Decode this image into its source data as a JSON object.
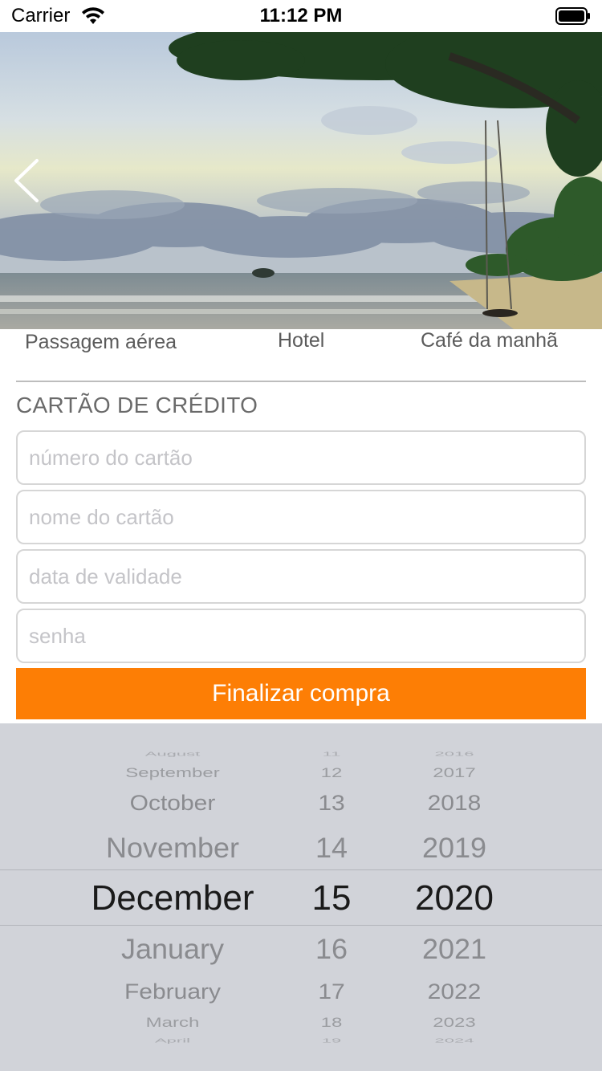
{
  "status_bar": {
    "carrier": "Carrier",
    "time": "11:12 PM"
  },
  "hero": {
    "image_description_icon": "beach-photo",
    "back_icon": "chevron-left-icon"
  },
  "tabs": [
    {
      "label": "Passagem aérea"
    },
    {
      "label": "Hotel"
    },
    {
      "label": "Café da manhã"
    }
  ],
  "section": {
    "title": "CARTÃO DE CRÉDITO"
  },
  "form": {
    "card_number_placeholder": "número do cartão",
    "card_name_placeholder": "nome do cartão",
    "expiry_placeholder": "data de validade",
    "password_placeholder": "senha",
    "submit_label": "Finalizar compra"
  },
  "colors": {
    "accent": "#fd7e05",
    "picker_bg": "#d1d3d9"
  },
  "date_picker": {
    "months": [
      "August",
      "September",
      "October",
      "November",
      "December",
      "January",
      "February",
      "March",
      "April"
    ],
    "days": [
      "11",
      "12",
      "13",
      "14",
      "15",
      "16",
      "17",
      "18",
      "19"
    ],
    "years": [
      "2016",
      "2017",
      "2018",
      "2019",
      "2020",
      "2021",
      "2022",
      "2023",
      "2024"
    ],
    "selected": {
      "month": "December",
      "day": "15",
      "year": "2020"
    }
  }
}
